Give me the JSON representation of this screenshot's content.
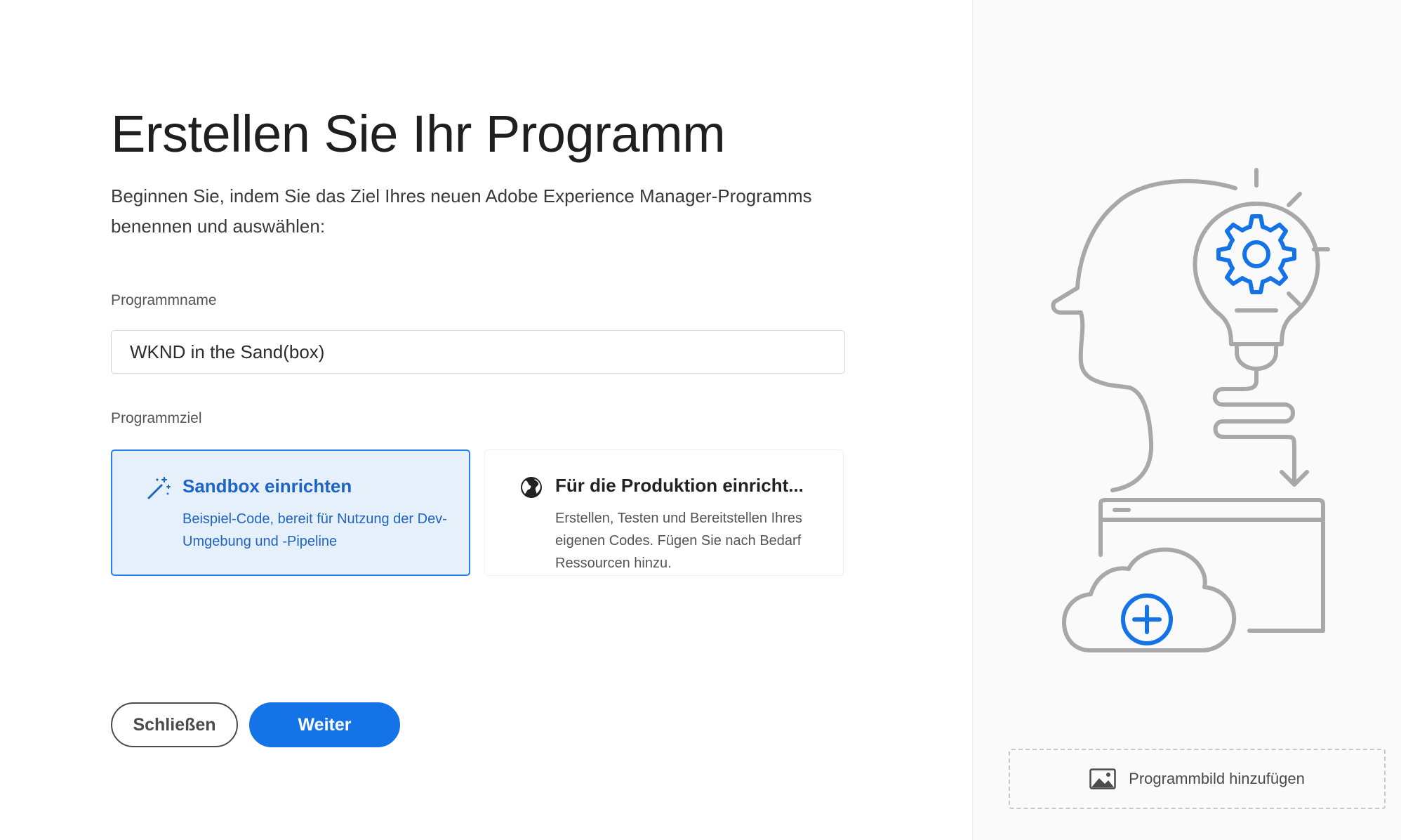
{
  "colors": {
    "accent": "#1473e6",
    "selected_bg": "#e6f0fb",
    "selected_border": "#2680eb",
    "selected_text": "#1e63c6",
    "illustration_gray": "#a8a8a8",
    "illustration_blue": "#1473e6"
  },
  "header": {
    "title": "Erstellen Sie Ihr Programm",
    "intro": "Beginnen Sie, indem Sie das Ziel Ihres neuen Adobe Experience Manager-Programms benennen und auswählen:"
  },
  "form": {
    "program_name": {
      "label": "Programmname",
      "value": "WKND in the Sand(box)"
    },
    "program_goal": {
      "label": "Programmziel",
      "options": [
        {
          "title": "Sandbox einrichten",
          "description": "Beispiel-Code, bereit für Nutzung der Dev-Umgebung und -Pipeline",
          "icon": "magic-wand-icon",
          "selected": true
        },
        {
          "title": "Für die Produktion einricht...",
          "description": "Erstellen, Testen und Bereitstellen Ihres eigenen Codes. Fügen Sie nach Bedarf Ressourcen hinzu.",
          "icon": "globe-icon",
          "selected": false
        }
      ]
    }
  },
  "actions": {
    "close_label": "Schließen",
    "next_label": "Weiter"
  },
  "side_panel": {
    "illustration_icon": "head-lightbulb-gear-cloud-illustration",
    "add_image_label": "Programmbild hinzufügen",
    "add_image_icon": "image-icon"
  }
}
